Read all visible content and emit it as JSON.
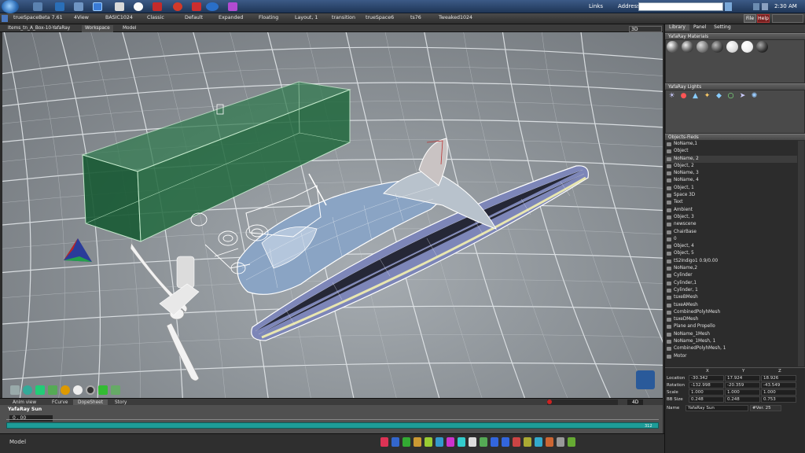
{
  "taskbar": {
    "links_label": "Links",
    "address_label": "Address",
    "clock": "2:30 AM"
  },
  "tabs": [
    "trueSpaceBeta 7.61",
    "4View",
    "BASIC1024",
    "Classic",
    "Default",
    "Expanded",
    "Floating",
    "Layout, 1",
    "transition",
    "trueSpace6",
    "ts76",
    "Tweaked1024"
  ],
  "window_buttons": {
    "file": "File",
    "help": "Help"
  },
  "docbar": {
    "doc_title": "Items_tn_A_Box-10-YafaRay",
    "tabs": [
      "Workspace",
      "Model"
    ],
    "view_mode": "3D"
  },
  "right_panel": {
    "tabs": [
      "Library",
      "Panel",
      "Setting"
    ],
    "materials_title": "YafaRay Materials",
    "lights_title": "YafaRay Lights",
    "objects_title": "Objects-Fieds",
    "objects": [
      "NoName,1",
      "Object",
      "NoName, 2",
      "Object, 2",
      "NoName, 3",
      "NoName, 4",
      "Object, 1",
      "Space 3D",
      "Text",
      "Ambient",
      "Object, 3",
      "newscene",
      "ChairBase",
      "0",
      "Object, 4",
      "Object, 5",
      "tS2Indigo1 0.9/0.00",
      "NoName,2",
      "Cylinder",
      "Cylinder,1",
      "Cylinder, 1",
      "tsxeBMesh",
      "tsxeAMesh",
      "CombinedPolyhMesh",
      "tsxeDMesh",
      "Plane and Propello",
      "NoName_1Mesh",
      "NoName_1Mesh, 1",
      "CombinedPolyhMesh, 1",
      "Motor"
    ]
  },
  "properties": {
    "axes": [
      "X",
      "Y",
      "Z"
    ],
    "rows": [
      {
        "label": "Location",
        "values": [
          "-30.342",
          "17.924",
          "18.926"
        ]
      },
      {
        "label": "Rotation",
        "values": [
          "-132.998",
          "-20.359",
          "-43.549"
        ]
      },
      {
        "label": "Scale",
        "values": [
          "1.000",
          "1.000",
          "1.000"
        ]
      },
      {
        "label": "BB Size",
        "values": [
          "0.248",
          "0.248",
          "0.753"
        ]
      }
    ],
    "name_label": "Name",
    "name_value": "YafaRay Sun",
    "version": "#Ver. 25"
  },
  "anim": {
    "tabs": [
      "Anim view",
      "FCurve",
      "DopeSheet",
      "Story"
    ],
    "track_name": "YafaRay Sun",
    "frame": "0 . 00",
    "end_frame": "312",
    "mode": "4D"
  },
  "bottom": {
    "mode_label": "Model"
  },
  "colors": {
    "timeline": "#1e9c98",
    "box": "#1f6a3b",
    "wing_fill": "#7d86b8"
  }
}
